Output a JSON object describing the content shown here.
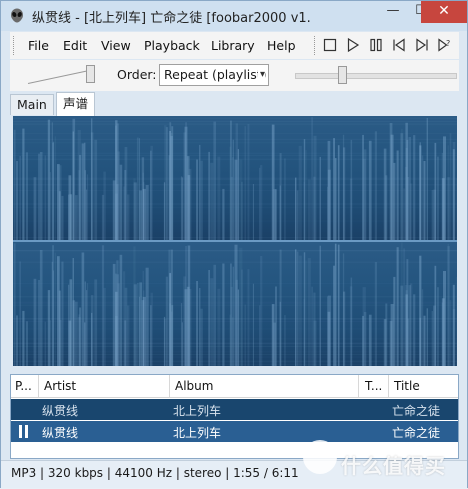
{
  "window": {
    "title": "纵贯线 - [北上列车] 亡命之徒   [foobar2000 v1.",
    "controls": {
      "minimize": "—",
      "maximize": "☐",
      "close": "✕"
    }
  },
  "menubar": {
    "items": [
      "File",
      "Edit",
      "View",
      "Playback",
      "Library",
      "Help"
    ],
    "transport_icons": [
      "stop-icon",
      "play-icon",
      "pause-icon",
      "previous-icon",
      "next-icon",
      "random-icon"
    ]
  },
  "toolbar": {
    "volume_percent": 100,
    "order_label": "Order:",
    "order_value": "Repeat (playlist)",
    "seek_fraction": 0.283
  },
  "tabs": [
    {
      "label": "Main",
      "active": false
    },
    {
      "label": "声谱",
      "active": true
    }
  ],
  "visualization": {
    "type": "spectrogram",
    "channels": 2,
    "colors": {
      "background": "#1c3f63",
      "band": "#2b5b86",
      "highlight": "#8fb9dd"
    }
  },
  "playlist": {
    "columns": [
      "P...",
      "Artist",
      "Album",
      "T...",
      "Title"
    ],
    "rows": [
      {
        "status": "",
        "artist": "纵贯线",
        "album": "北上列车",
        "track": "",
        "title": "亡命之徒",
        "selected": true,
        "playing": false
      },
      {
        "status": "paused",
        "artist": "纵贯线",
        "album": "北上列车",
        "track": "",
        "title": "亡命之徒",
        "selected": true,
        "playing": true
      }
    ]
  },
  "statusbar": {
    "text": "MP3 | 320 kbps | 44100 Hz | stereo | 1:55 / 6:11"
  },
  "watermark": {
    "text": "什么值得买"
  }
}
